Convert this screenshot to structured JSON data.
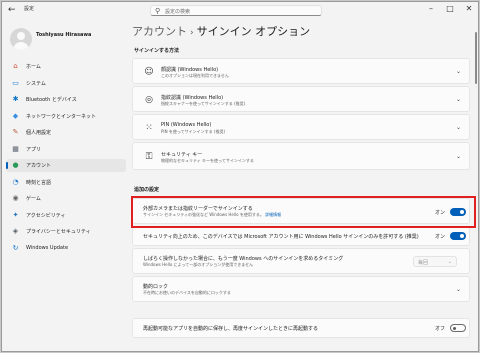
{
  "app": {
    "title": "設定"
  },
  "search": {
    "placeholder": "設定の検索"
  },
  "user": {
    "name": "Toshiyasu Hirasawa"
  },
  "nav": [
    {
      "label": "ホーム",
      "icon": "home-icon",
      "glyph": "⌂",
      "color": "#d24b35"
    },
    {
      "label": "システム",
      "icon": "system-icon",
      "glyph": "▭",
      "color": "#0a72c9"
    },
    {
      "label": "Bluetooth とデバイス",
      "icon": "bluetooth-icon",
      "glyph": "✱",
      "color": "#0a72c9"
    },
    {
      "label": "ネットワークとインターネット",
      "icon": "network-icon",
      "glyph": "◆",
      "color": "#3c8fe0"
    },
    {
      "label": "個人用設定",
      "icon": "personalization-icon",
      "glyph": "✎",
      "color": "#b35a3c"
    },
    {
      "label": "アプリ",
      "icon": "apps-icon",
      "glyph": "▦",
      "color": "#555e6a"
    },
    {
      "label": "アカウント",
      "icon": "accounts-icon",
      "glyph": "●",
      "color": "#2c9b5a",
      "active": true
    },
    {
      "label": "時刻と言語",
      "icon": "time-language-icon",
      "glyph": "◔",
      "color": "#2a7fd4"
    },
    {
      "label": "ゲーム",
      "icon": "gaming-icon",
      "glyph": "◉",
      "color": "#666666"
    },
    {
      "label": "アクセシビリティ",
      "icon": "accessibility-icon",
      "glyph": "✦",
      "color": "#1f6fc0"
    },
    {
      "label": "プライバシーとセキュリティ",
      "icon": "privacy-icon",
      "glyph": "◈",
      "color": "#555e6a"
    },
    {
      "label": "Windows Update",
      "icon": "windows-update-icon",
      "glyph": "↻",
      "color": "#0a72c9"
    }
  ],
  "breadcrumb": {
    "parent": "アカウント",
    "separator": "›",
    "current": "サインイン オプション"
  },
  "signin": {
    "heading": "サインインする方法",
    "items": [
      {
        "title": "顔認識 (Windows Hello)",
        "sub": "このオプションは現在利用できません",
        "icon": "face-recognition-icon",
        "glyph": "☺"
      },
      {
        "title": "指紋認識 (Windows Hello)",
        "sub": "指紋スキャナーを使ってサインインする (推奨)",
        "icon": "fingerprint-icon",
        "glyph": "◎"
      },
      {
        "title": "PIN (Windows Hello)",
        "sub": "PIN を使ってサインインする (推奨)",
        "icon": "pin-icon",
        "glyph": "⁙"
      },
      {
        "title": "セキュリティ キー",
        "sub": "物理的なセキュリティ キーを使ってサインインする",
        "icon": "security-key-icon",
        "glyph": "⚿"
      }
    ]
  },
  "additional": {
    "heading": "追加の設定",
    "external_camera": {
      "title": "外部カメラまたは指紋リーダーでサインインする",
      "sub": "サインイン セキュリティの強化など Windows Hello を使用する。",
      "link": "詳細情報",
      "state": "オン",
      "on": true
    },
    "hello_only": {
      "title": "セキュリティ向上のため、このデバイスでは Microsoft アカウント用に Windows Hello サインインのみを許可する (推奨)",
      "state": "オン",
      "on": true
    },
    "away_timing": {
      "title": "しばらく操作しなかった場合に、もう一度 Windows へのサインインを求めるタイミング",
      "sub": "Windows Hello によって一部のオプションが使用できません",
      "value": "毎回"
    },
    "dynamic_lock": {
      "title": "動的ロック",
      "sub": "不在時にお使いのデバイスを自動的にロックする"
    },
    "restart_apps": {
      "title": "再起動可能なアプリを自動的に保存し、再度サインインしたときに再起動する",
      "state": "オフ",
      "on": false
    }
  },
  "colors": {
    "accent": "#005fb8",
    "highlight": "#e02020"
  }
}
